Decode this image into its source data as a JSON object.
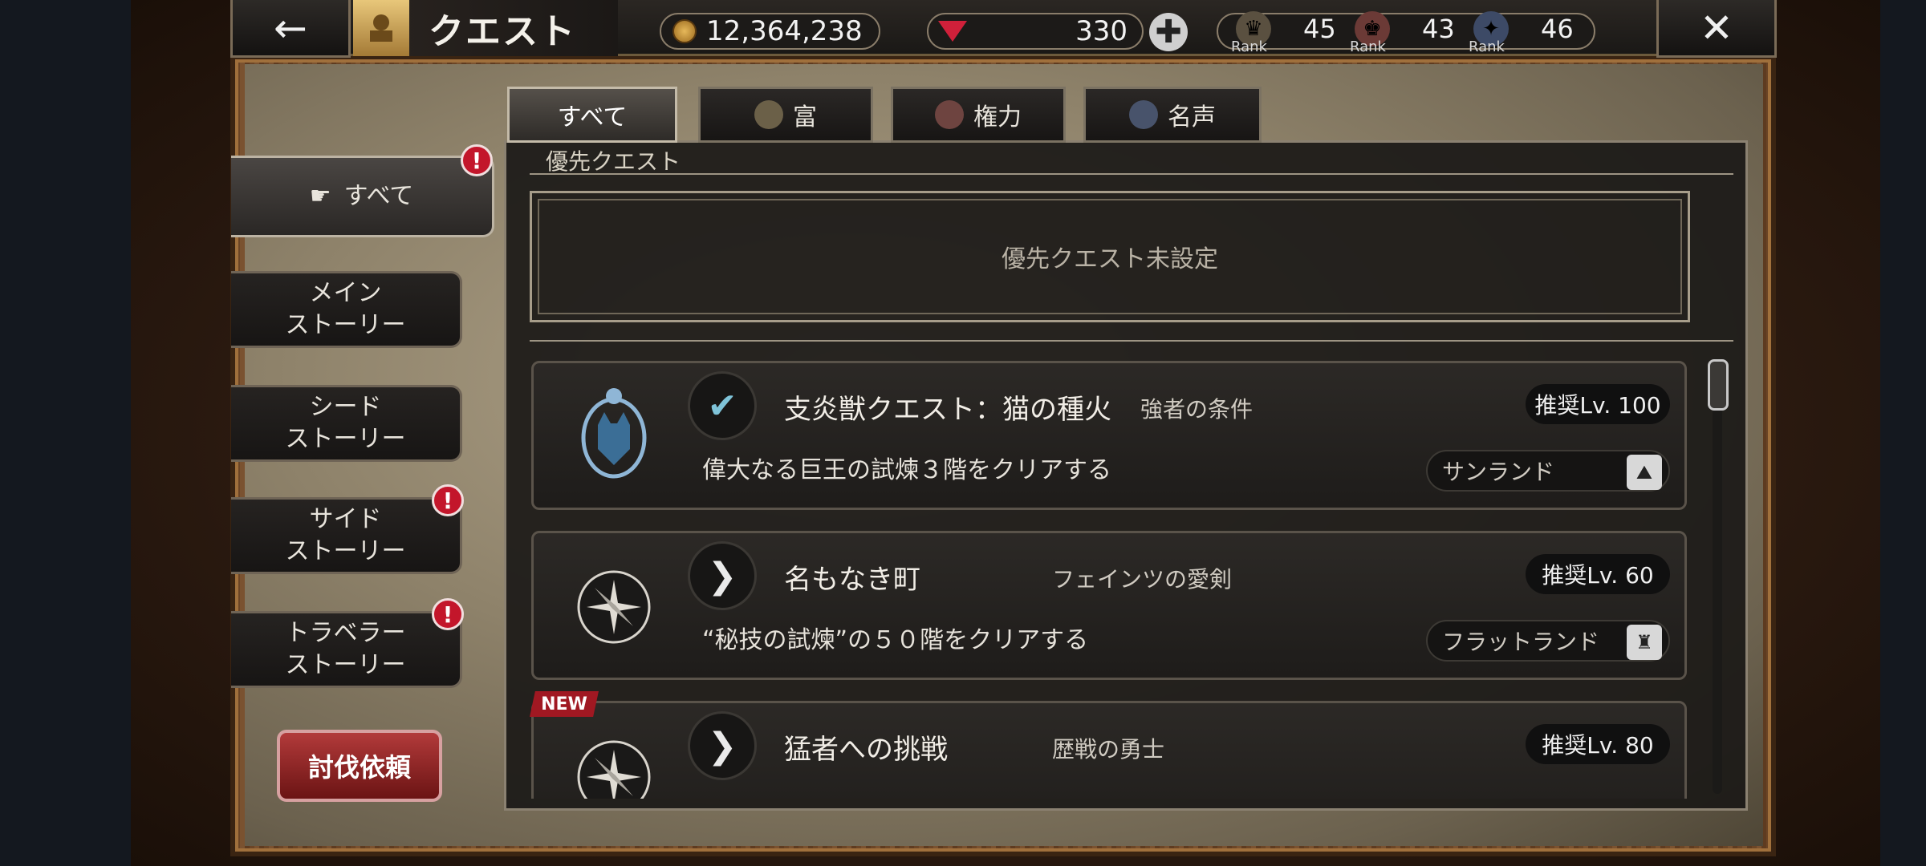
{
  "header": {
    "back_icon": "←",
    "title": "クエスト",
    "close_icon": "✕",
    "gold": "12,364,238",
    "gems": "330",
    "plus_icon": "✚",
    "ranks": [
      {
        "icon": "wealth-rank-icon",
        "label": "Rank",
        "value": "45",
        "color": "#cfc29a"
      },
      {
        "icon": "power-rank-icon",
        "label": "Rank",
        "value": "43",
        "color": "#d9a9a0"
      },
      {
        "icon": "fame-rank-icon",
        "label": "Rank",
        "value": "46",
        "color": "#a8b6cf"
      }
    ]
  },
  "categories": [
    {
      "label": "すべて",
      "icon": "pointing-hand-icon",
      "active": true,
      "alert": true
    },
    {
      "label": "メイン\nストーリー",
      "alert": false
    },
    {
      "label": "シード\nストーリー",
      "alert": false
    },
    {
      "label": "サイド\nストーリー",
      "alert": true
    },
    {
      "label": "トラベラー\nストーリー",
      "alert": true
    }
  ],
  "alert_mark": "!",
  "subjugation_button": "討伐依頼",
  "tabs": [
    {
      "label": "すべて",
      "active": true
    },
    {
      "label": "富",
      "active": false
    },
    {
      "label": "権力",
      "active": false
    },
    {
      "label": "名声",
      "active": false
    }
  ],
  "priority": {
    "label": "優先クエスト",
    "empty_text": "優先クエスト未設定"
  },
  "quests": [
    {
      "status": "✔",
      "title": "支炎獣クエスト：猫の種火",
      "subtitle": "強者の条件",
      "level": "推奨Lv. 100",
      "description": "偉大なる巨王の試煉３階をクリアする",
      "location": "サンランド",
      "new": false
    },
    {
      "status": "❯",
      "title": "名もなき町",
      "subtitle": "フェインツの愛剣",
      "level": "推奨Lv.  60",
      "description": "“秘技の試煉”の５０階をクリアする",
      "location": "フラットランド",
      "new": false
    },
    {
      "status": "❯",
      "title": "猛者への挑戦",
      "subtitle": "歴戦の勇士",
      "level": "推奨Lv.  80",
      "description": "",
      "location": "",
      "new": true,
      "new_label": "NEW"
    }
  ]
}
